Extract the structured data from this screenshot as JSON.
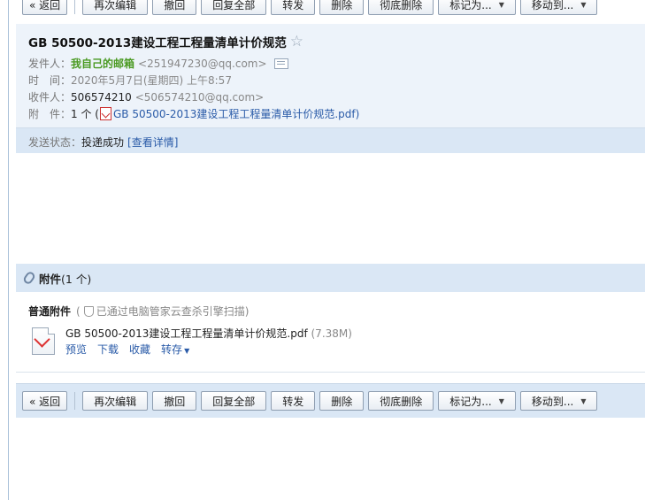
{
  "toolbar": {
    "back": "« 返回",
    "reedit": "再次编辑",
    "recall": "撤回",
    "reply_all": "回复全部",
    "forward": "转发",
    "delete": "删除",
    "delete_perm": "彻底删除",
    "mark_as": "标记为...",
    "move_to": "移动到..."
  },
  "mail": {
    "subject": "GB 50500-2013建设工程工程量清单计价规范",
    "from_label": "发件人：",
    "from_name": "我自己的邮箱",
    "from_addr": "<251947230@qq.com>",
    "time_label": "时　间：",
    "time_value": "2020年5月7日(星期四) 上午8:57",
    "to_label": "收件人：",
    "to_name": "506574210",
    "to_addr": "<506574210@qq.com>",
    "attach_label": "附　件：",
    "attach_count": "1 个 (",
    "attach_name": "GB 50500-2013建设工程工程量清单计价规范.pdf",
    "attach_close": ")",
    "status_label": "发送状态：",
    "status_value": "投递成功",
    "status_link": "[查看详情]"
  },
  "attachments": {
    "title": "附件",
    "count": "(1 个)",
    "section_label": "普通附件",
    "scan_open": "(",
    "scan_note": "已通过电脑管家云查杀引擎扫描",
    "scan_close": ")",
    "file_name": "GB 50500-2013建设工程工程量清单计价规范.pdf",
    "file_size": "(7.38M)",
    "actions": [
      "预览",
      "下载",
      "收藏",
      "转存"
    ]
  },
  "colors": {
    "header_bg": "#edf3fa",
    "bar_bg": "#dae7f5",
    "link": "#2a5ba8",
    "sender_green": "#4a9a22"
  }
}
